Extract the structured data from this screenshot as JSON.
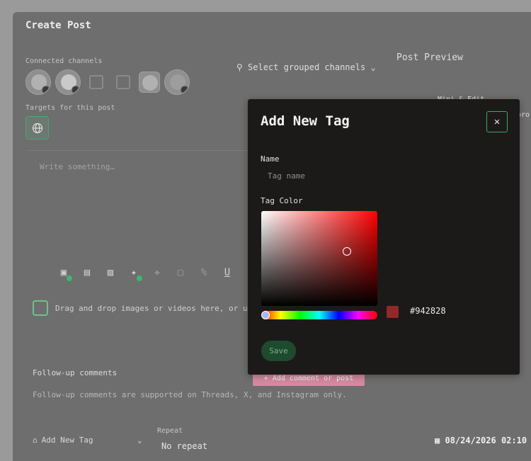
{
  "background": {
    "title": "Create Post",
    "connected_channels_label": "Connected channels",
    "targets_label": "Targets for this post",
    "grouped_channels": "Select grouped channels",
    "preview_label": "Post Preview",
    "editor_placeholder": "Write something…",
    "drop_zone_text": "Drag and drop images or videos here, or use",
    "followup_title": "Follow-up comments",
    "followup_note": "Follow-up comments are supported on Threads, X, and Instagram only.",
    "add_comment": "+ Add comment or post",
    "add_tag": "Add New Tag",
    "repeat_label": "Repeat",
    "repeat_value": "No repeat",
    "datetime": "08/24/2026 02:10",
    "peek_edit": "Mini & Edit",
    "peek_pro": "pro"
  },
  "modal": {
    "title": "Add New Tag",
    "name_label": "Name",
    "name_placeholder": "Tag name",
    "name_value": "",
    "color_label": "Tag Color",
    "hex_value": "#942828",
    "save_label": "Save"
  },
  "colors": {
    "swatch": "#942828",
    "accent_green": "#3fa864"
  }
}
